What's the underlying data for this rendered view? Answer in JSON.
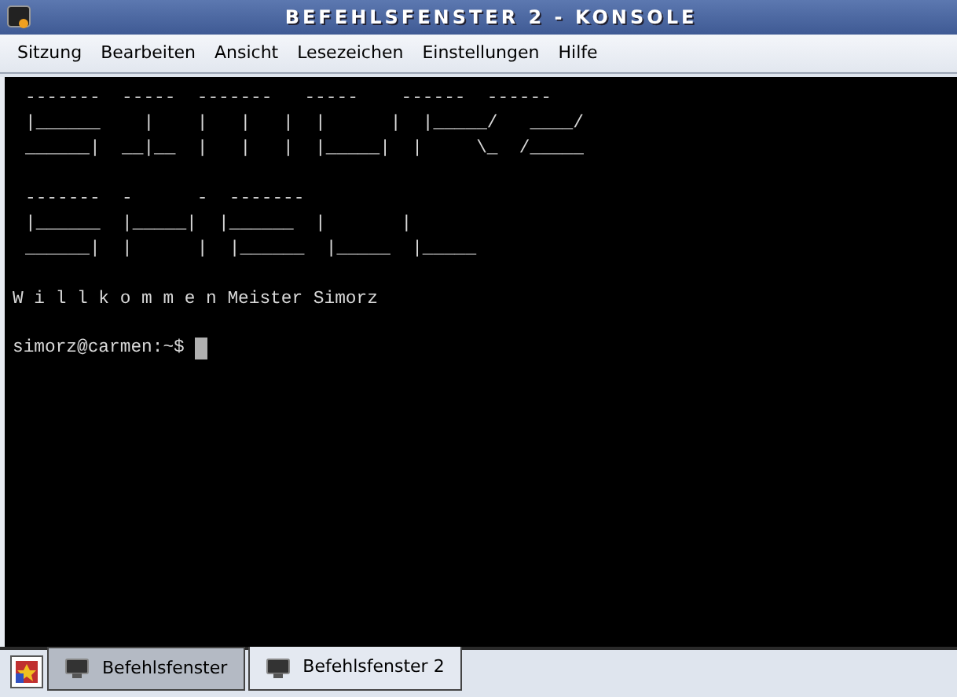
{
  "window": {
    "title": "BEFEHLSFENSTER 2 - KONSOLE"
  },
  "menu": [
    "Sitzung",
    "Bearbeiten",
    "Ansicht",
    "Lesezeichen",
    "Einstellungen",
    "Hilfe"
  ],
  "terminal": {
    "banner": [
      [
        "-------  -----  -------   -----    ------  ------",
        "|______    |    |   |   |  |      |  |_____/   ____/",
        "______|  __|__  |   |   |  |_____|  |     \\_  /_____"
      ],
      [
        "-------  -      -  -------",
        "|______  |_____|  |______  |       |",
        "______|  |      |  |______  |_____  |_____"
      ]
    ],
    "welcome": "W i l l k o m m e n Meister Simorz",
    "prompt": "simorz@carmen:~$"
  },
  "taskbar": {
    "tabs": [
      {
        "label": "Befehlsfenster",
        "selected": false
      },
      {
        "label": "Befehlsfenster 2",
        "selected": true
      }
    ]
  }
}
